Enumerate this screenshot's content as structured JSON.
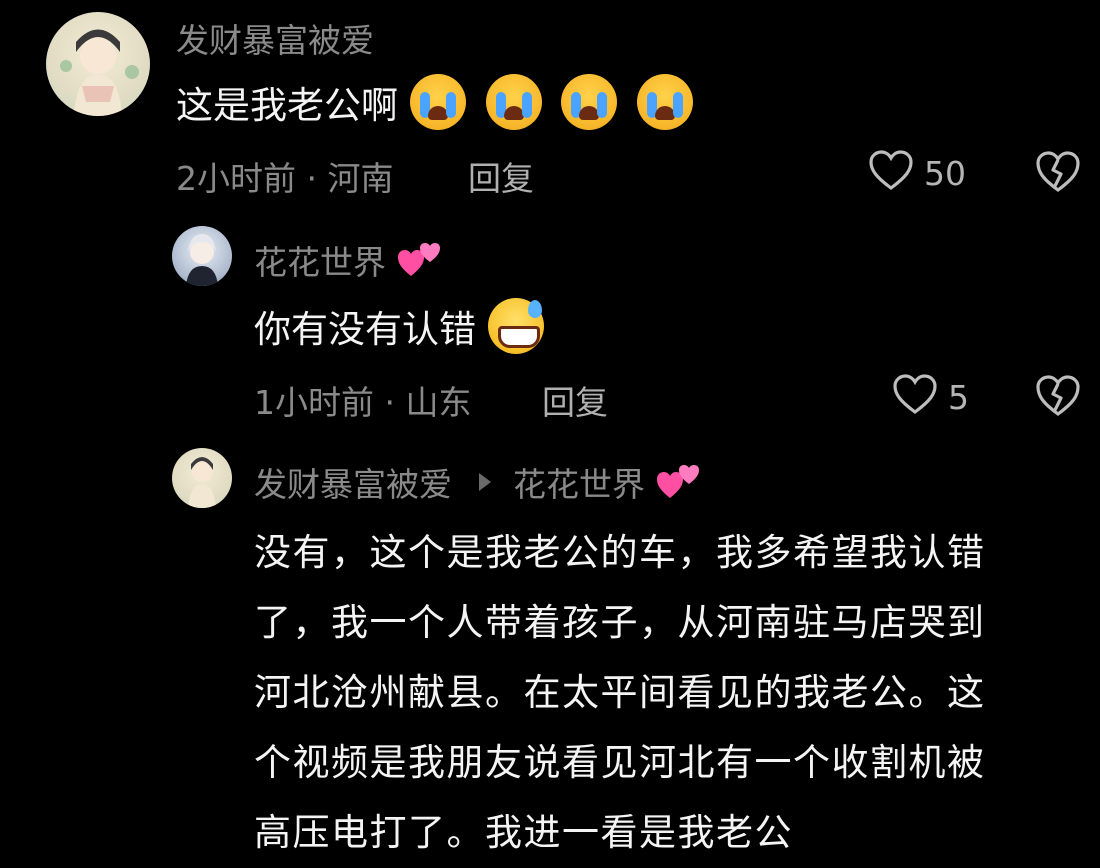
{
  "colors": {
    "background": "#000000",
    "text": "#f4f4f4",
    "muted": "#8a8a8a",
    "icon": "#bdbdbd"
  },
  "comment": {
    "username": "发财暴富被爱",
    "text": "这是我老公啊",
    "emoji": [
      "loudly-crying-face",
      "loudly-crying-face",
      "loudly-crying-face",
      "loudly-crying-face"
    ],
    "meta": "2小时前 · 河南",
    "reply_label": "回复",
    "likes": "50"
  },
  "reply1": {
    "username": "花花世界",
    "username_emoji": "revolving-hearts",
    "text": "你有没有认错",
    "emoji": "grinning-face-with-sweat",
    "meta": "1小时前 · 山东",
    "reply_label": "回复",
    "likes": "5"
  },
  "reply2": {
    "username": "发财暴富被爱",
    "reply_to": "花花世界",
    "reply_to_emoji": "revolving-hearts",
    "lines": [
      "没有，这个是我老公的车，我多希望我认错",
      "了，我一个人带着孩子，从河南驻马店哭到",
      "河北沧州献县。在太平间看见的我老公。这",
      "个视频是我朋友说看见河北有一个收割机被",
      "高压电打了。我进一看是我老公"
    ]
  }
}
